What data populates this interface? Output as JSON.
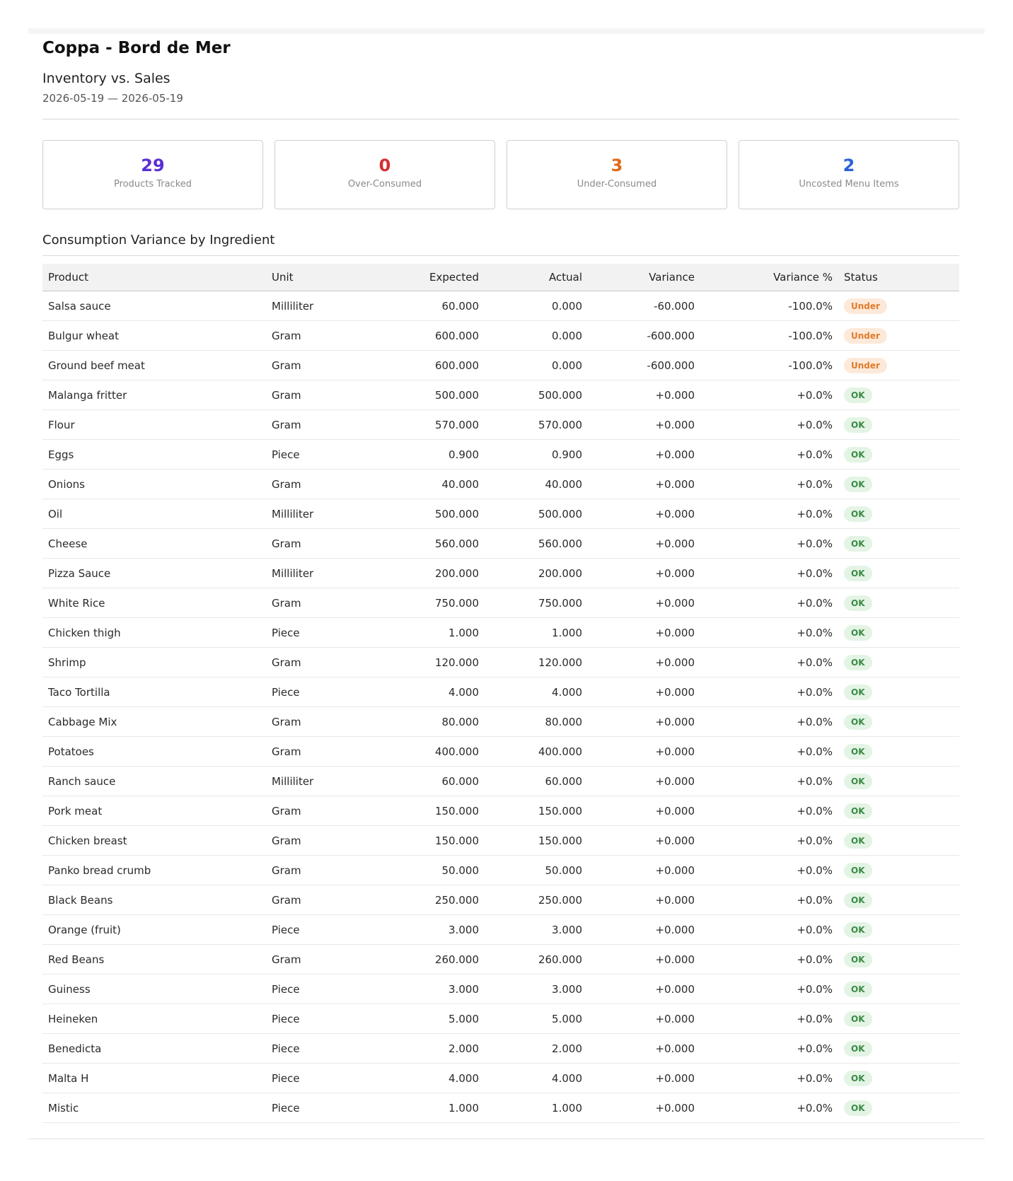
{
  "header": {
    "store_name": "Coppa - Bord de Mer",
    "report_title": "Inventory vs. Sales",
    "date_range": "2026-05-19 — 2026-05-19"
  },
  "stats": [
    {
      "value": "29",
      "label": "Products Tracked",
      "color": "#5b2fd4"
    },
    {
      "value": "0",
      "label": "Over-Consumed",
      "color": "#d42e2e"
    },
    {
      "value": "3",
      "label": "Under-Consumed",
      "color": "#e06a18"
    },
    {
      "value": "2",
      "label": "Uncosted Menu Items",
      "color": "#2b62d4"
    }
  ],
  "section": {
    "title": "Consumption Variance by Ingredient"
  },
  "table": {
    "headers": {
      "product": "Product",
      "unit": "Unit",
      "expected": "Expected",
      "actual": "Actual",
      "variance": "Variance",
      "variance_pct": "Variance %",
      "status": "Status"
    },
    "rows": [
      {
        "product": "Salsa sauce",
        "unit": "Milliliter",
        "expected": "60.000",
        "actual": "0.000",
        "variance": "-60.000",
        "variance_pct": "-100.0%",
        "status": "Under"
      },
      {
        "product": "Bulgur wheat",
        "unit": "Gram",
        "expected": "600.000",
        "actual": "0.000",
        "variance": "-600.000",
        "variance_pct": "-100.0%",
        "status": "Under"
      },
      {
        "product": "Ground beef meat",
        "unit": "Gram",
        "expected": "600.000",
        "actual": "0.000",
        "variance": "-600.000",
        "variance_pct": "-100.0%",
        "status": "Under"
      },
      {
        "product": "Malanga fritter",
        "unit": "Gram",
        "expected": "500.000",
        "actual": "500.000",
        "variance": "+0.000",
        "variance_pct": "+0.0%",
        "status": "OK"
      },
      {
        "product": "Flour",
        "unit": "Gram",
        "expected": "570.000",
        "actual": "570.000",
        "variance": "+0.000",
        "variance_pct": "+0.0%",
        "status": "OK"
      },
      {
        "product": "Eggs",
        "unit": "Piece",
        "expected": "0.900",
        "actual": "0.900",
        "variance": "+0.000",
        "variance_pct": "+0.0%",
        "status": "OK"
      },
      {
        "product": "Onions",
        "unit": "Gram",
        "expected": "40.000",
        "actual": "40.000",
        "variance": "+0.000",
        "variance_pct": "+0.0%",
        "status": "OK"
      },
      {
        "product": "Oil",
        "unit": "Milliliter",
        "expected": "500.000",
        "actual": "500.000",
        "variance": "+0.000",
        "variance_pct": "+0.0%",
        "status": "OK"
      },
      {
        "product": "Cheese",
        "unit": "Gram",
        "expected": "560.000",
        "actual": "560.000",
        "variance": "+0.000",
        "variance_pct": "+0.0%",
        "status": "OK"
      },
      {
        "product": "Pizza Sauce",
        "unit": "Milliliter",
        "expected": "200.000",
        "actual": "200.000",
        "variance": "+0.000",
        "variance_pct": "+0.0%",
        "status": "OK"
      },
      {
        "product": "White Rice",
        "unit": "Gram",
        "expected": "750.000",
        "actual": "750.000",
        "variance": "+0.000",
        "variance_pct": "+0.0%",
        "status": "OK"
      },
      {
        "product": "Chicken thigh",
        "unit": "Piece",
        "expected": "1.000",
        "actual": "1.000",
        "variance": "+0.000",
        "variance_pct": "+0.0%",
        "status": "OK"
      },
      {
        "product": "Shrimp",
        "unit": "Gram",
        "expected": "120.000",
        "actual": "120.000",
        "variance": "+0.000",
        "variance_pct": "+0.0%",
        "status": "OK"
      },
      {
        "product": "Taco Tortilla",
        "unit": "Piece",
        "expected": "4.000",
        "actual": "4.000",
        "variance": "+0.000",
        "variance_pct": "+0.0%",
        "status": "OK"
      },
      {
        "product": "Cabbage Mix",
        "unit": "Gram",
        "expected": "80.000",
        "actual": "80.000",
        "variance": "+0.000",
        "variance_pct": "+0.0%",
        "status": "OK"
      },
      {
        "product": "Potatoes",
        "unit": "Gram",
        "expected": "400.000",
        "actual": "400.000",
        "variance": "+0.000",
        "variance_pct": "+0.0%",
        "status": "OK"
      },
      {
        "product": "Ranch sauce",
        "unit": "Milliliter",
        "expected": "60.000",
        "actual": "60.000",
        "variance": "+0.000",
        "variance_pct": "+0.0%",
        "status": "OK"
      },
      {
        "product": "Pork meat",
        "unit": "Gram",
        "expected": "150.000",
        "actual": "150.000",
        "variance": "+0.000",
        "variance_pct": "+0.0%",
        "status": "OK"
      },
      {
        "product": "Chicken breast",
        "unit": "Gram",
        "expected": "150.000",
        "actual": "150.000",
        "variance": "+0.000",
        "variance_pct": "+0.0%",
        "status": "OK"
      },
      {
        "product": "Panko bread crumb",
        "unit": "Gram",
        "expected": "50.000",
        "actual": "50.000",
        "variance": "+0.000",
        "variance_pct": "+0.0%",
        "status": "OK"
      },
      {
        "product": "Black Beans",
        "unit": "Gram",
        "expected": "250.000",
        "actual": "250.000",
        "variance": "+0.000",
        "variance_pct": "+0.0%",
        "status": "OK"
      },
      {
        "product": "Orange (fruit)",
        "unit": "Piece",
        "expected": "3.000",
        "actual": "3.000",
        "variance": "+0.000",
        "variance_pct": "+0.0%",
        "status": "OK"
      },
      {
        "product": "Red Beans",
        "unit": "Gram",
        "expected": "260.000",
        "actual": "260.000",
        "variance": "+0.000",
        "variance_pct": "+0.0%",
        "status": "OK"
      },
      {
        "product": "Guiness",
        "unit": "Piece",
        "expected": "3.000",
        "actual": "3.000",
        "variance": "+0.000",
        "variance_pct": "+0.0%",
        "status": "OK"
      },
      {
        "product": "Heineken",
        "unit": "Piece",
        "expected": "5.000",
        "actual": "5.000",
        "variance": "+0.000",
        "variance_pct": "+0.0%",
        "status": "OK"
      },
      {
        "product": "Benedicta",
        "unit": "Piece",
        "expected": "2.000",
        "actual": "2.000",
        "variance": "+0.000",
        "variance_pct": "+0.0%",
        "status": "OK"
      },
      {
        "product": "Malta H",
        "unit": "Piece",
        "expected": "4.000",
        "actual": "4.000",
        "variance": "+0.000",
        "variance_pct": "+0.0%",
        "status": "OK"
      },
      {
        "product": "Mistic",
        "unit": "Piece",
        "expected": "1.000",
        "actual": "1.000",
        "variance": "+0.000",
        "variance_pct": "+0.0%",
        "status": "OK"
      }
    ]
  }
}
